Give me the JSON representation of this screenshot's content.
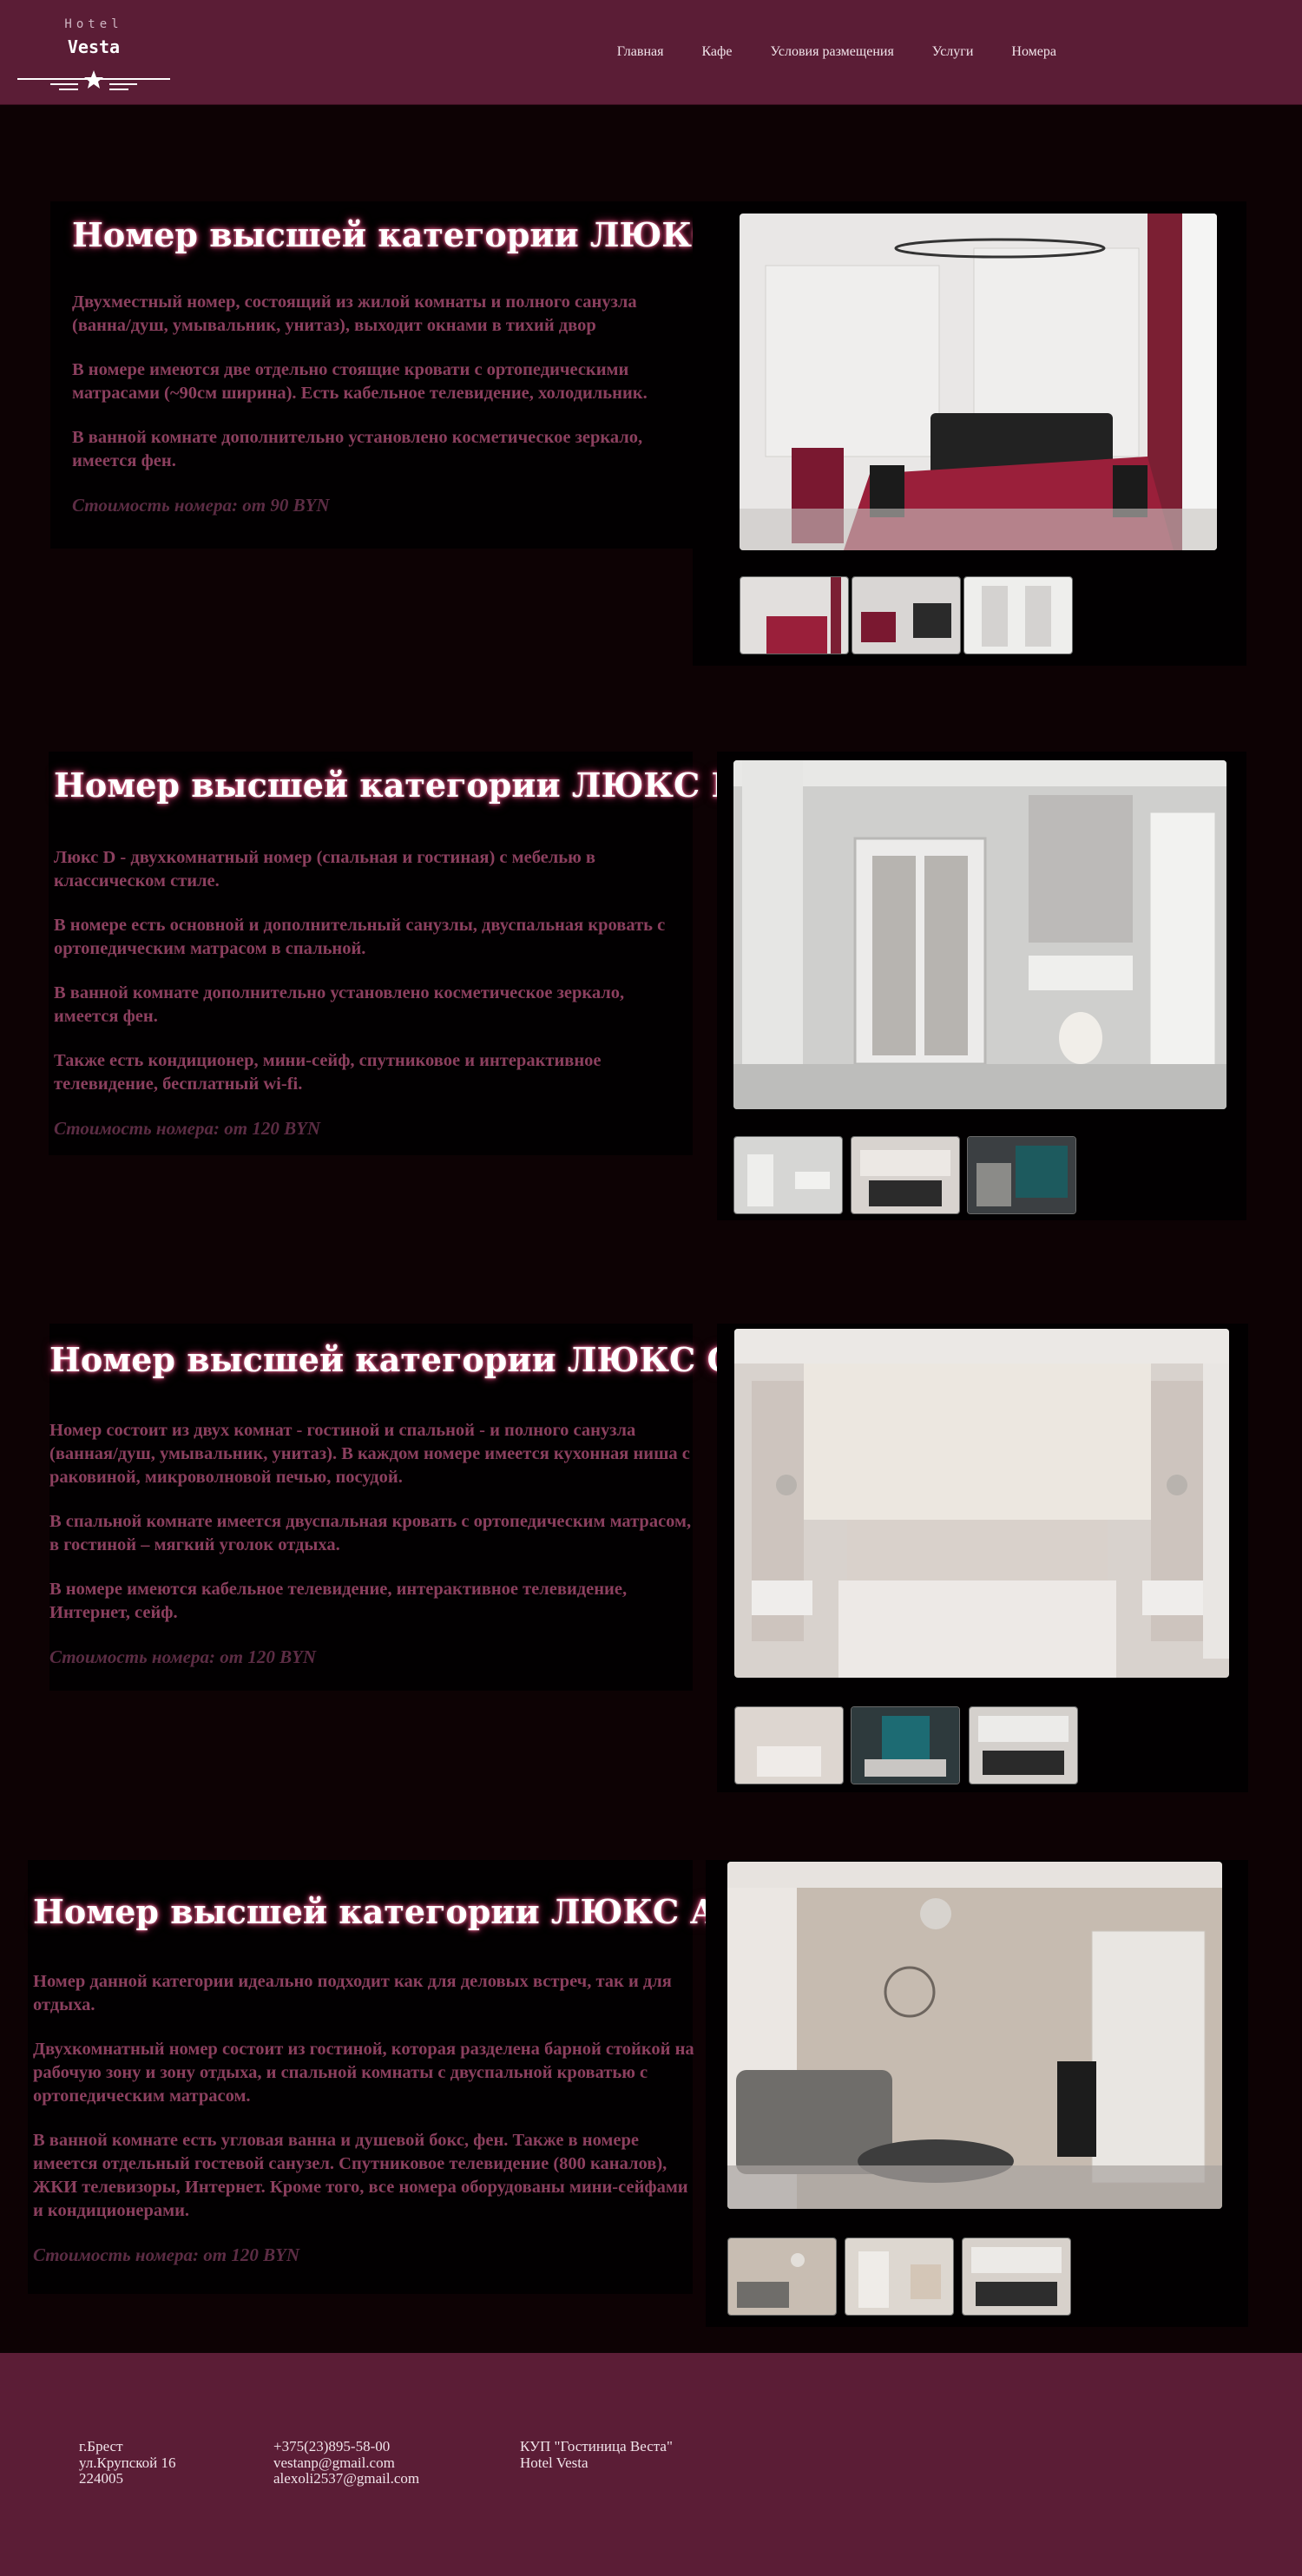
{
  "header": {
    "logo_top": "Hotel",
    "logo_name": "Vesta",
    "nav": [
      "Главная",
      "Кафе",
      "Условия размещения",
      "Услуги",
      "Номера"
    ]
  },
  "rooms": [
    {
      "title": "Номер высшей категории ЛЮКС B",
      "paragraphs": [
        "Двухместный номер, состоящий из жилой комнаты и полного санузла (ванна/душ, умывальник, унитаз), выходит окнами в тихий двор",
        "В номере имеются две отдельно стоящие кровати с ортопедическими матрасами (~90см ширина). Есть кабельное телевидение, холодильник.",
        "В ванной комнате дополнительно установлено косметическое зеркало, имеется фен."
      ],
      "price": "Стоимость номера: от 90 BYN"
    },
    {
      "title": "Номер высшей категории ЛЮКС D",
      "paragraphs": [
        "Люкс D - двухкомнатный номер (спальная и гостиная) с мебелью в классическом стиле.",
        "В номере есть основной и дополнительный санузлы, двуспальная кровать с ортопедическим матрасом в спальной.",
        "В ванной комнате дополнительно установлено косметическое зеркало, имеется фен.",
        "Также есть кондиционер, мини-сейф, спутниковое и интерактивное телевидение, бесплатный wi-fi."
      ],
      "price": "Стоимость номера: от 120 BYN"
    },
    {
      "title": "Номер высшей категории ЛЮКС C",
      "paragraphs": [
        "Номер состоит из двух комнат - гостиной и спальной - и полного санузла (ванная/душ, умывальник, унитаз). В каждом номере имеется кухонная ниша с раковиной, микроволновой печью, посудой.",
        "В спальной комнате имеется двуспальная кровать с ортопедическим матрасом, в гостиной – мягкий уголок отдыха.",
        "В номере имеются кабельное телевидение, интерактивное телевидение, Интернет, сейф."
      ],
      "price": "Стоимость номера: от 120 BYN"
    },
    {
      "title": "Номер высшей категории ЛЮКС A",
      "paragraphs": [
        "Номер данной категории идеально подходит как для деловых встреч, так и для отдыха.",
        "Двухкомнатный номер состоит из гостиной, которая разделена барной стойкой на рабочую зону и зону отдыха, и спальной комнаты с двуспальной кроватью с ортопедическим матрасом.",
        "В ванной комнате есть угловая ванна и душевой бокс, фен. Также в номере имеется отдельный гостевой санузел. Спутниковое телевидение (800 каналов), ЖКИ телевизоры, Интернет. Кроме того, все номера оборудованы мини-сейфами и кондиционерами."
      ],
      "price": "Стоимость номера: от 120 BYN"
    }
  ],
  "footer": {
    "address": [
      "г.Брест",
      "ул.Крупской 16",
      "224005"
    ],
    "contacts": [
      "+375(23)895-58-00",
      "vestanp@gmail.com",
      "alexoli2537@gmail.com"
    ],
    "company": [
      "КУП \"Гостиница Веста\"",
      "Hotel Vesta"
    ]
  },
  "colors": {
    "header_bg": "#5b1d36",
    "page_bg": "#0d0204",
    "panel_bg": "#020001",
    "desc_text": "#8b3f5e",
    "price_text": "#5c2c44"
  },
  "icons": [
    "star-icon"
  ]
}
